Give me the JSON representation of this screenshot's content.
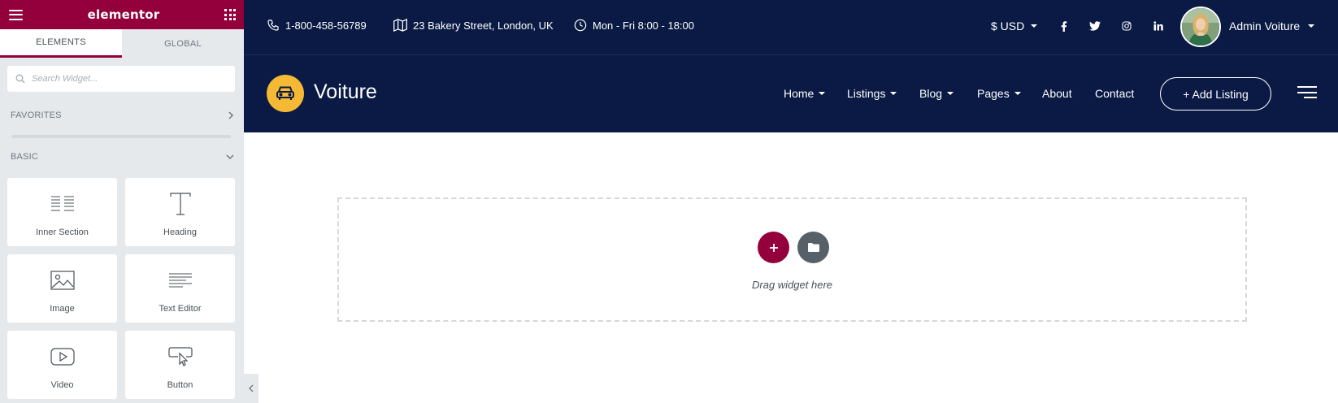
{
  "panel": {
    "brand": "elementor",
    "tabs": [
      {
        "label": "ELEMENTS",
        "active": true
      },
      {
        "label": "GLOBAL",
        "active": false
      }
    ],
    "search_placeholder": "Search Widget...",
    "sections": {
      "favorites": "FAVORITES",
      "basic": "BASIC"
    },
    "widgets": [
      {
        "label": "Inner Section",
        "icon": "inner-section-icon"
      },
      {
        "label": "Heading",
        "icon": "heading-icon"
      },
      {
        "label": "Image",
        "icon": "image-icon"
      },
      {
        "label": "Text Editor",
        "icon": "text-editor-icon"
      },
      {
        "label": "Video",
        "icon": "video-icon"
      },
      {
        "label": "Button",
        "icon": "button-icon"
      }
    ],
    "accent": "#93003c"
  },
  "topbar": {
    "phone": "1-800-458-56789",
    "address": "23 Bakery Street, London, UK",
    "hours": "Mon - Fri 8:00 - 18:00",
    "currency": "$ USD",
    "socials": [
      "facebook-icon",
      "twitter-icon",
      "instagram-icon",
      "linkedin-icon"
    ],
    "user_name": "Admin Voiture"
  },
  "navbar": {
    "logo_text": "Voiture",
    "items": [
      {
        "label": "Home",
        "dropdown": true
      },
      {
        "label": "Listings",
        "dropdown": true
      },
      {
        "label": "Blog",
        "dropdown": true
      },
      {
        "label": "Pages",
        "dropdown": true
      },
      {
        "label": "About",
        "dropdown": false
      },
      {
        "label": "Contact",
        "dropdown": false
      }
    ],
    "cta": "+ Add Listing",
    "background": "#0a1a44",
    "logo_color": "#f5b935"
  },
  "canvas": {
    "drag_text": "Drag widget here"
  }
}
